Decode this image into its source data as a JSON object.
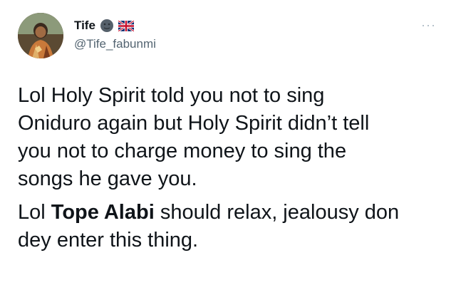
{
  "tweet": {
    "author": {
      "display_name": "Tife",
      "handle": "@Tife_fabunmi",
      "badge_icon": "dark-emoji-icon",
      "flag_icon": "uk-flag-icon"
    },
    "more_label": "···",
    "paragraphs": [
      {
        "lines": [
          "Lol Holy Spirit told you not to sing",
          "Oniduro again but Holy Spirit didn’t tell",
          "you not to charge money to sing the",
          "songs he gave you."
        ]
      }
    ],
    "paragraph2": {
      "prefix": "Lol ",
      "bold": "Tope Alabi",
      "suffix_line1": " should relax, jealousy don",
      "line2": "dey enter this thing."
    }
  }
}
